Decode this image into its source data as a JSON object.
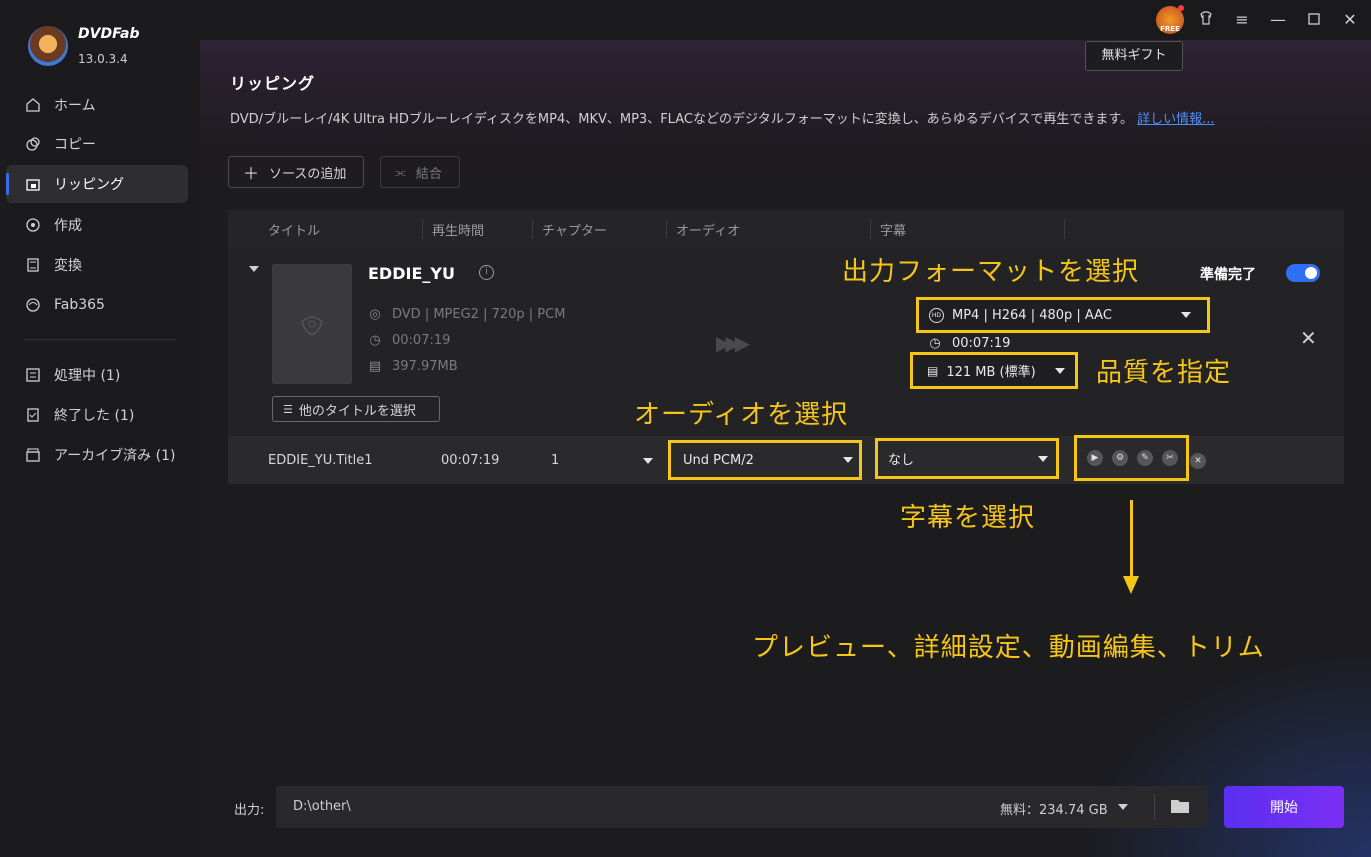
{
  "app": {
    "brand": "DVDFab",
    "version": "13.0.3.4"
  },
  "topbar": {
    "gift_tooltip": "無料ギフト",
    "free_badge": "FREE"
  },
  "sidebar": {
    "items": [
      {
        "label": "ホーム",
        "icon": "home-icon"
      },
      {
        "label": "コピー",
        "icon": "copy-icon"
      },
      {
        "label": "リッピング",
        "icon": "ripper-icon",
        "active": true
      },
      {
        "label": "作成",
        "icon": "creator-icon"
      },
      {
        "label": "変換",
        "icon": "converter-icon"
      },
      {
        "label": "Fab365",
        "icon": "fab365-icon"
      }
    ],
    "queue": [
      {
        "label": "処理中 (1)",
        "icon": "processing-icon"
      },
      {
        "label": "終了した (1)",
        "icon": "finished-icon"
      },
      {
        "label": "アーカイブ済み (1)",
        "icon": "archive-icon"
      }
    ]
  },
  "page": {
    "title": "リッピング",
    "description": "DVD/ブルーレイ/4K Ultra HDブルーレイディスクをMP4、MKV、MP3、FLACなどのデジタルフォーマットに変換し、あらゆるデバイスで再生できます。",
    "more_link": "詳しい情報..."
  },
  "toolbar": {
    "add_source": "ソースの追加",
    "merge": "結合"
  },
  "columns": [
    "タイトル",
    "再生時間",
    "チャプター",
    "オーディオ",
    "字幕"
  ],
  "title_item": {
    "name": "EDDIE_YU",
    "ready_label": "準備完了",
    "source_info": "DVD | MPEG2 | 720p | PCM",
    "source_duration": "00:07:19",
    "source_size": "397.97MB",
    "other_titles_button": "他のタイトルを選択",
    "output_format": "MP4 | H264 | 480p | AAC",
    "output_duration": "00:07:19",
    "output_quality": "121 MB (標準)"
  },
  "title_row": {
    "name": "EDDIE_YU.Title1",
    "duration": "00:07:19",
    "chapter": "1",
    "audio": "Und  PCM/2",
    "subtitle": "なし"
  },
  "annotations": {
    "format": "出力フォーマットを選択",
    "quality": "品質を指定",
    "audio": "オーディオを選択",
    "subtitle": "字幕を選択",
    "tools": "プレビュー、詳細設定、動画編集、トリム"
  },
  "bottom": {
    "output_label": "出力:",
    "output_path": "D:\\other\\",
    "free_space": "無料：234.74 GB",
    "start": "開始"
  },
  "colors": {
    "accent": "#2f6ef5",
    "annotation": "#f5c518",
    "start_gradient": "#6a2ff3"
  }
}
